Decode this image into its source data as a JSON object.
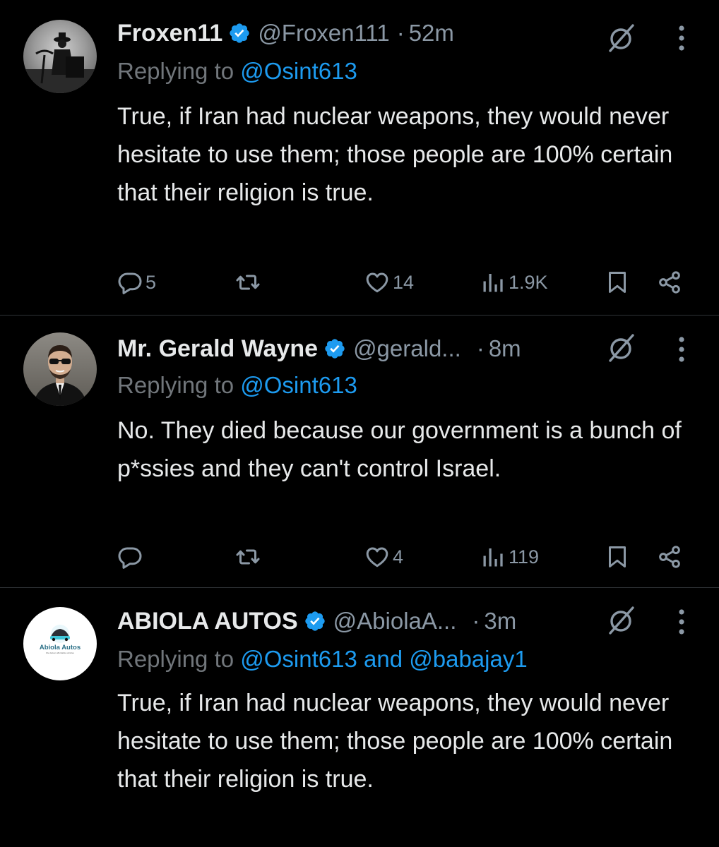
{
  "tweets": [
    {
      "name": "Froxen11",
      "handle": "@Froxen111",
      "time": "52m",
      "replying_prefix": "Replying to ",
      "replying_to": "@Osint613",
      "text": "True, if Iran had nuclear weapons, they would never hesitate to use them; those people are 100% certain that their religion is true.",
      "replies": "5",
      "retweets": "",
      "likes": "14",
      "views": "1.9K"
    },
    {
      "name": "Mr. Gerald Wayne",
      "handle": "@gerald...",
      "time": "8m",
      "replying_prefix": "Replying to ",
      "replying_to": "@Osint613",
      "text": "No. They died because our government is a bunch of p*ssies and they can't control Israel.",
      "replies": "",
      "retweets": "",
      "likes": "4",
      "views": "119"
    },
    {
      "name": "ABIOLA AUTOS",
      "handle": "@AbiolaA...",
      "time": "3m",
      "replying_prefix": "Replying to ",
      "replying_to": "@Osint613 and @babajay1",
      "text": "True, if Iran had nuclear weapons, they would never hesitate to use them; those people are 100% certain that their religion is true.",
      "avatar_logo_text": "Abiola Autos",
      "avatar_logo_tagline": "We deliver affordable vehicles"
    }
  ],
  "separator": "·",
  "colors": {
    "background": "#000000",
    "text": "#e7e9ea",
    "muted": "#71767b",
    "link": "#1d9bf0",
    "verified": "#1d9bf0",
    "divider": "#2f3336"
  },
  "icons": [
    "verified-badge-icon",
    "grok-icon",
    "more-icon",
    "reply-icon",
    "retweet-icon",
    "like-icon",
    "views-icon",
    "bookmark-icon",
    "share-icon"
  ]
}
